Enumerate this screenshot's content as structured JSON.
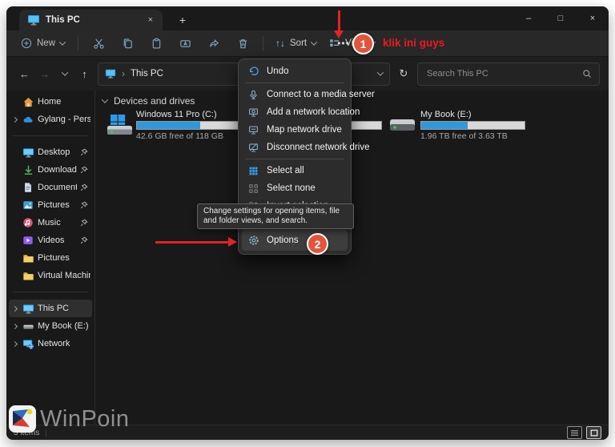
{
  "colors": {
    "accent_blue": "#3398db",
    "annotation_red": "#e8191f",
    "annotation_circle_fill": "#e2553a",
    "menu_bg": "#2c2c2c",
    "window_bg": "#191919"
  },
  "titlebar": {
    "tab_label": "This PC",
    "close_glyph": "×",
    "new_tab_glyph": "+",
    "minimize_glyph": "–",
    "maximize_glyph": "□"
  },
  "toolbar": {
    "new_label": "New",
    "sort_glyph": "↑↓",
    "sort_label": "Sort",
    "view_label": "View",
    "more_glyph": "•••"
  },
  "addressbar": {
    "back_glyph": "←",
    "forward_glyph": "→",
    "up_glyph": "↑",
    "refresh_glyph": "↻",
    "breadcrumb_sep": "›",
    "breadcrumb": "This PC",
    "search_placeholder": "Search This PC"
  },
  "sidebar": {
    "items": [
      {
        "label": "Home",
        "icon": "home-icon"
      },
      {
        "label": "Gylang - Personal",
        "icon": "onedrive-cloud-icon"
      },
      {
        "label": "Desktop",
        "icon": "desktop-monitor-icon",
        "pinned": true
      },
      {
        "label": "Downloads",
        "icon": "downloads-icon",
        "pinned": true
      },
      {
        "label": "Documents",
        "icon": "document-icon",
        "pinned": true
      },
      {
        "label": "Pictures",
        "icon": "pictures-icon",
        "pinned": true
      },
      {
        "label": "Music",
        "icon": "music-icon",
        "pinned": true
      },
      {
        "label": "Videos",
        "icon": "videos-icon",
        "pinned": true
      },
      {
        "label": "Pictures",
        "icon": "folder-icon"
      },
      {
        "label": "Virtual Machine",
        "icon": "folder-icon"
      },
      {
        "label": "This PC",
        "icon": "this-pc-monitor-icon",
        "selected": true
      },
      {
        "label": "My Book (E:)",
        "icon": "drive-icon"
      },
      {
        "label": "Network",
        "icon": "network-icon"
      }
    ]
  },
  "content": {
    "section_label": "Devices and drives",
    "drives": [
      {
        "name": "Windows 11 Pro (C:)",
        "detail": "42.6 GB free of 118 GB",
        "used_pct": 61
      },
      {
        "name": "My Book (E:)",
        "detail": "1.96 TB free of 3.63 TB",
        "used_pct": 45
      }
    ],
    "occluded_drive_bar": {
      "used_pct": 60
    }
  },
  "menu": {
    "items": [
      {
        "label": "Undo",
        "icon": "undo-icon"
      },
      {
        "label": "Connect to a media server",
        "icon": "media-server-icon"
      },
      {
        "label": "Add a network location",
        "icon": "add-network-location-icon"
      },
      {
        "label": "Map network drive",
        "icon": "map-network-drive-icon"
      },
      {
        "label": "Disconnect network drive",
        "icon": "disconnect-network-drive-icon"
      },
      {
        "label": "Select all",
        "icon": "select-all-icon"
      },
      {
        "label": "Select none",
        "icon": "select-none-icon"
      },
      {
        "label": "Invert selection",
        "icon": "invert-selection-icon"
      },
      {
        "label": "Options",
        "icon": "options-gear-icon"
      }
    ]
  },
  "tooltip": {
    "text": "Change settings for opening items, file and folder views, and search."
  },
  "annotations": {
    "step1_number": "1",
    "step1_text": "klik ini guys",
    "step2_number": "2"
  },
  "statusbar": {
    "items_count": "3 items",
    "divider": "|"
  },
  "watermark": {
    "text": "WinPoin"
  }
}
